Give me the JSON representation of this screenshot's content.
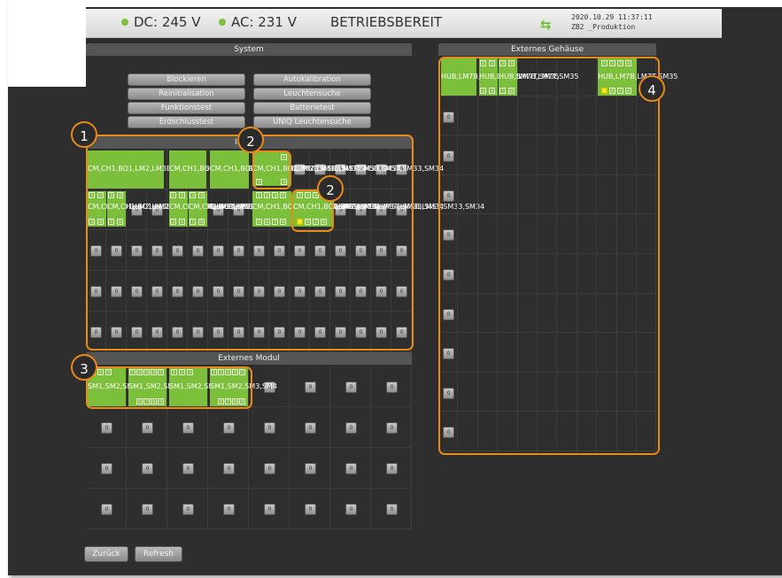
{
  "header": {
    "dc": "DC: 245 V",
    "ac": "AC: 231 V",
    "status": "BETRIEBSBEREIT",
    "timestamp": "2020.10.29 11:37:11",
    "location": "ZB2 _Produktion"
  },
  "system": {
    "title": "System",
    "buttons": [
      "Blockieren",
      "Autokalibration",
      "Reinitialisation",
      "Leuchtensuche",
      "Funktionstest",
      "Batterietest",
      "Erdschlusstest",
      "UNIQ Leuchtensuche"
    ]
  },
  "internal": {
    "title": "Interne Module",
    "visible_title": "Inter       le",
    "modules": [
      "CM",
      "CH1",
      "BO1",
      "LM2",
      "LM3B",
      "LM3T",
      "LM5B",
      "LM5T",
      "SM33",
      "SM34"
    ],
    "slot_label": "0"
  },
  "external_module": {
    "title": "Externes Modul",
    "modules": [
      "SM1",
      "SM2",
      "SM3",
      "SM4"
    ]
  },
  "external_housing": {
    "title": "Externes Gehäuse",
    "modules": [
      "HUB",
      "LM7B",
      "LM7T",
      "SM35"
    ]
  },
  "badges": [
    "1",
    "2",
    "2",
    "3",
    "4"
  ],
  "footer": {
    "back": "Zurück",
    "refresh": "Refresh"
  },
  "colors": {
    "module": "#7bbf3a",
    "highlight": "#e88a1a",
    "warn": "#f1e300",
    "background": "#2e2e2e"
  }
}
